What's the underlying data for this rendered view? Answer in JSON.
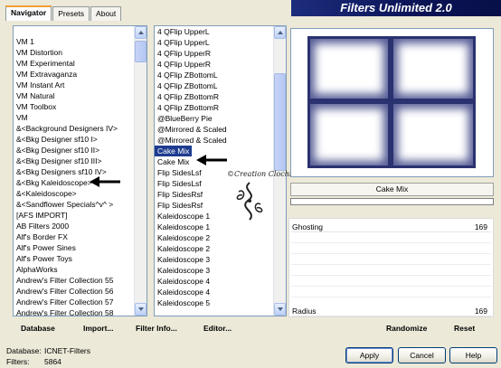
{
  "tabs": [
    "Navigator",
    "Presets",
    "About"
  ],
  "banner": "Filters Unlimited 2.0",
  "left_list": {
    "items": [
      "VM 1",
      "VM Distortion",
      "VM Experimental",
      "VM Extravaganza",
      "VM Instant Art",
      "VM Natural",
      "VM Toolbox",
      "VM",
      "&<Background Designers IV>",
      "&<Bkg Designer sf10 I>",
      "&<Bkg Designer sf10 II>",
      "&<Bkg Designer sf10 III>",
      "&<Bkg Designers sf10 IV>",
      "&<Bkg Kaleidoscope>",
      "&<Kaleidoscope>",
      "&<Sandflower Specials^v^ >",
      "[AFS IMPORT]",
      "AB Filters 2000",
      "Alf's Border FX",
      "Alf's Power Sines",
      "Alf's Power Toys",
      "AlphaWorks",
      "Andrew's Filter Collection 55",
      "Andrew's Filter Collection 56",
      "Andrew's Filter Collection 57",
      "Andrew's Filter Collection 58"
    ]
  },
  "right_list": {
    "items": [
      "4 QFlip UpperL",
      "4 QFlip UpperL",
      "4 QFlip UpperR",
      "4 QFlip UpperR",
      "4 QFlip ZBottomL",
      "4 QFlip ZBottomL",
      "4 QFlip ZBottomR",
      "4 QFlip ZBottomR",
      "@BlueBerry Pie",
      "@Mirrored & Scaled",
      "@Mirrored & Scaled",
      "Cake Mix",
      "Cake Mix",
      "Flip SidesLsf",
      "Flip SidesLsf",
      "Flip SidesRsf",
      "Flip SidesRsf",
      "Kaleidoscope 1",
      "Kaleidoscope 1",
      "Kaleidoscope 2",
      "Kaleidoscope 2",
      "Kaleidoscope 3",
      "Kaleidoscope 3",
      "Kaleidoscope 4",
      "Kaleidoscope 4",
      "Kaleidoscope 5"
    ],
    "selected_index": 11
  },
  "watermark": "©Creation Clochi",
  "filter_name": "Cake Mix",
  "sliders": [
    {
      "label": "Ghosting",
      "value": "169"
    },
    {
      "label": "Radius",
      "value": "169"
    }
  ],
  "toolbar": {
    "database": "Database",
    "import": "Import...",
    "filter_info": "Filter Info...",
    "editor": "Editor...",
    "randomize": "Randomize",
    "reset": "Reset"
  },
  "status": {
    "database_label": "Database:",
    "database_value": "ICNET-Filters",
    "filters_label": "Filters:",
    "filters_value": "5864"
  },
  "buttons": {
    "apply": "Apply",
    "cancel": "Cancel",
    "help": "Help"
  }
}
